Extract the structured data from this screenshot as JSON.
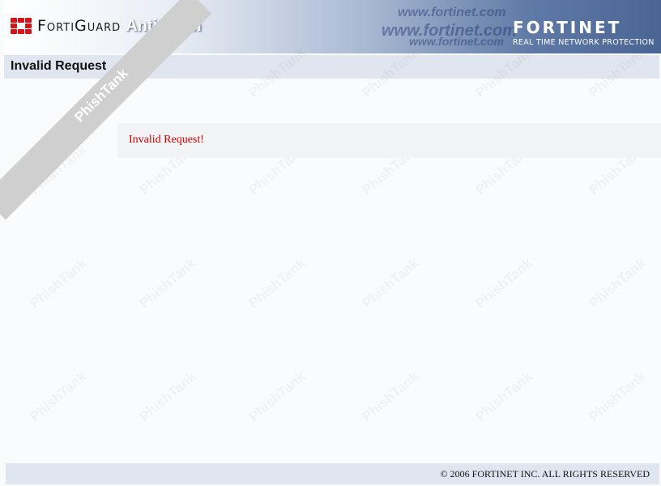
{
  "header": {
    "brand": "FortiGuard",
    "product": "AntiSpam",
    "url_watermark": "www.fortinet.com",
    "company": "FORTINET",
    "tagline": "REAL TIME NETWORK PROTECTION",
    "accent_color": "#d3141b"
  },
  "page": {
    "title": "Invalid Request",
    "message": "Invalid Request!",
    "message_color": "#cc0000"
  },
  "footer": {
    "copyright": "© 2006 FORTINET INC. ALL RIGHTS RESERVED"
  },
  "overlay": {
    "ribbon_text": "PhishTank",
    "watermark_text": "PhishTank"
  }
}
